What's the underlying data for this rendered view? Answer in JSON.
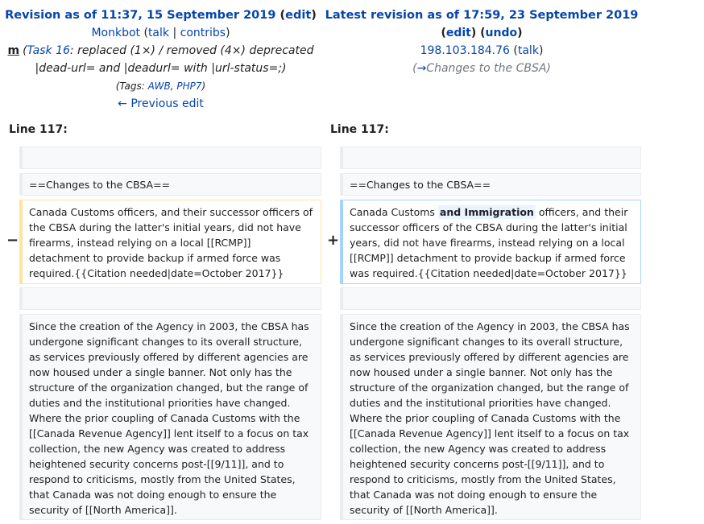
{
  "left": {
    "title_prefix": "Revision as of 11:37, 15 September 2019",
    "edit": "edit",
    "user": "Monkbot",
    "talk": "talk",
    "contribs": "contribs",
    "minor_mark": "m",
    "summary_task_link": "Task 16",
    "summary_rest": ": replaced (1×) / removed (4×) deprecated |dead-url= and |deadurl= with |url-status=;",
    "tags_label": "Tags: ",
    "tag1": "AWB",
    "tag2": "PHP7",
    "prev_edit": "← Previous edit",
    "line_label": "Line 117:"
  },
  "right": {
    "title_prefix": "Latest revision as of 17:59, 23 September 2019",
    "edit": "edit",
    "undo": "undo",
    "user": "198.103.184.76",
    "talk": "talk",
    "summary_arrow": "→",
    "summary_section": "Changes to the CBSA",
    "line_label": "Line 117:"
  },
  "diff": {
    "heading": "==Changes to the CBSA==",
    "deleted_text": "Canada Customs officers, and their successor officers of the CBSA during the latter's initial years, did not have firearms, instead relying on a local [[RCMP]] detachment to provide backup if armed force was required.{{Citation needed|date=October 2017}}",
    "added_before": "Canada Customs ",
    "added_inserted": "and Immigration",
    "added_after": " officers, and their successor officers of the CBSA during the latter's initial years, did not have firearms, instead relying on a local [[RCMP]] detachment to provide backup if armed force was required.{{Citation needed|date=October 2017}}",
    "context_paragraph": "Since the creation of the Agency in 2003, the CBSA has undergone significant changes to its overall structure, as services previously offered by different agencies are now housed under a single banner. Not only has the structure of the organization changed, but the range of duties and the institutional priorities have changed. Where the prior coupling of Canada Customs with the [[Canada Revenue Agency]] lent itself to a focus on tax collection, the new Agency was created to address heightened security concerns post-[[9/11]], and to respond to criticisms, mostly from the United States, that Canada was not doing enough to ensure the security of [[North America]].",
    "minus": "−",
    "plus": "+"
  },
  "colors": {
    "link": "#0645ad",
    "deleted_border": "#ffe49c",
    "added_border": "#a3d3ff",
    "context_bg": "#f8f9fa"
  }
}
